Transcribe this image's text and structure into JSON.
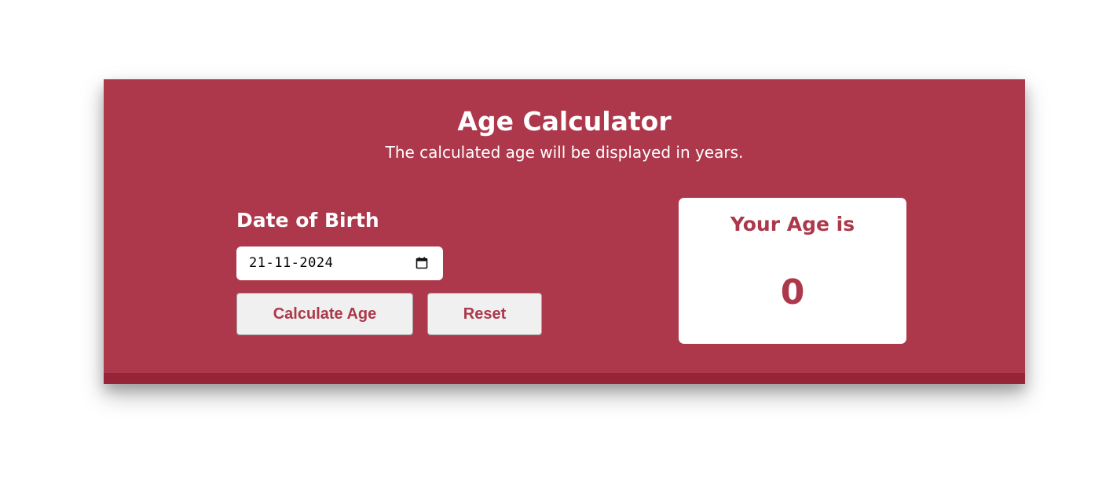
{
  "header": {
    "title": "Age Calculator",
    "subtitle": "The calculated age will be displayed in years."
  },
  "form": {
    "dob_label": "Date of Birth",
    "date_value": "21-11-2024",
    "date_icon": "calendar-icon",
    "calculate_label": "Calculate Age",
    "reset_label": "Reset"
  },
  "result": {
    "label": "Your Age is",
    "value": "0"
  },
  "colors": {
    "accent": "#ad384b",
    "accent_dark": "#97253a",
    "button_bg": "#f0f0f0",
    "panel_bg": "#ffffff"
  }
}
